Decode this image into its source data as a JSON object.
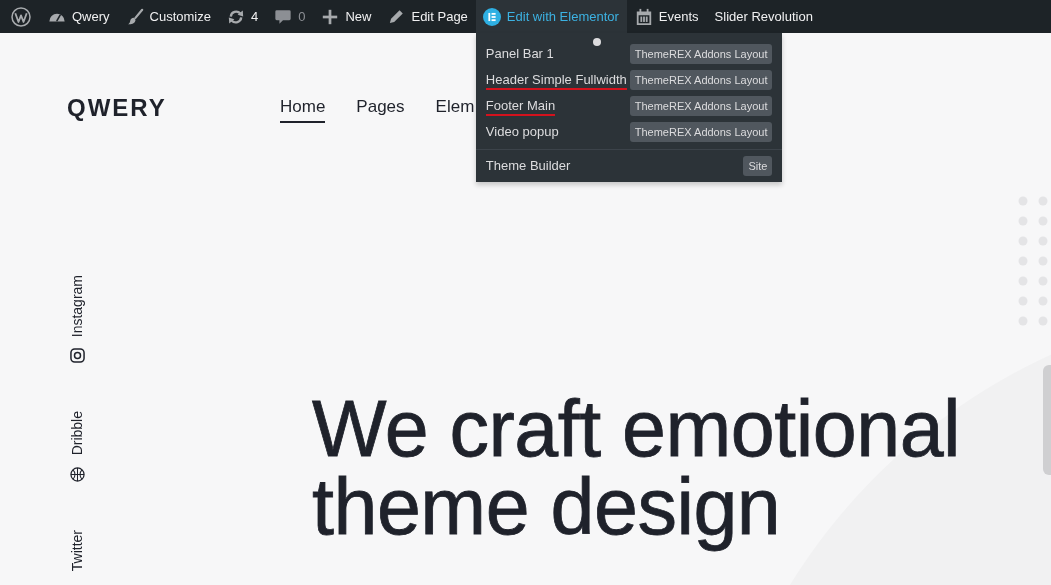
{
  "admin_bar": {
    "items": [
      {
        "kind": "site",
        "label": "Qwery",
        "selected": false
      },
      {
        "kind": "customize",
        "label": "Customize",
        "selected": false
      },
      {
        "kind": "updates",
        "label": "4",
        "selected": false
      },
      {
        "kind": "comments",
        "label": "0",
        "selected": false
      },
      {
        "kind": "new",
        "label": "New",
        "selected": false
      },
      {
        "kind": "edit",
        "label": "Edit Page",
        "selected": false
      },
      {
        "kind": "elementor",
        "label": "Edit with Elementor",
        "selected": true
      },
      {
        "kind": "events",
        "label": "Events",
        "selected": false
      },
      {
        "kind": "plain",
        "label": "Slider Revolution",
        "selected": false
      }
    ]
  },
  "elementor_menu": {
    "items": [
      {
        "label": "Panel Bar 1",
        "badge": "ThemeREX Addons Layout",
        "underlined": false
      },
      {
        "label": "Header Simple Fullwidth",
        "badge": "ThemeREX Addons Layout",
        "underlined": true
      },
      {
        "label": "Footer Main",
        "badge": "ThemeREX Addons Layout",
        "underlined": true
      },
      {
        "label": "Video popup",
        "badge": "ThemeREX Addons Layout",
        "underlined": false
      }
    ],
    "theme_builder": {
      "label": "Theme Builder",
      "badge": "Site"
    }
  },
  "site_header": {
    "logo": "QWERY",
    "nav": [
      {
        "label": "Home",
        "selected": true
      },
      {
        "label": "Pages",
        "selected": false
      },
      {
        "label": "Elem",
        "selected": false
      }
    ]
  },
  "social_links": [
    {
      "kind": "instagram",
      "label": "Instagram"
    },
    {
      "kind": "dribbble",
      "label": "Dribble"
    },
    {
      "kind": "twitter",
      "label": "Twitter"
    }
  ],
  "hero": {
    "title": "We craft emotional theme design"
  }
}
